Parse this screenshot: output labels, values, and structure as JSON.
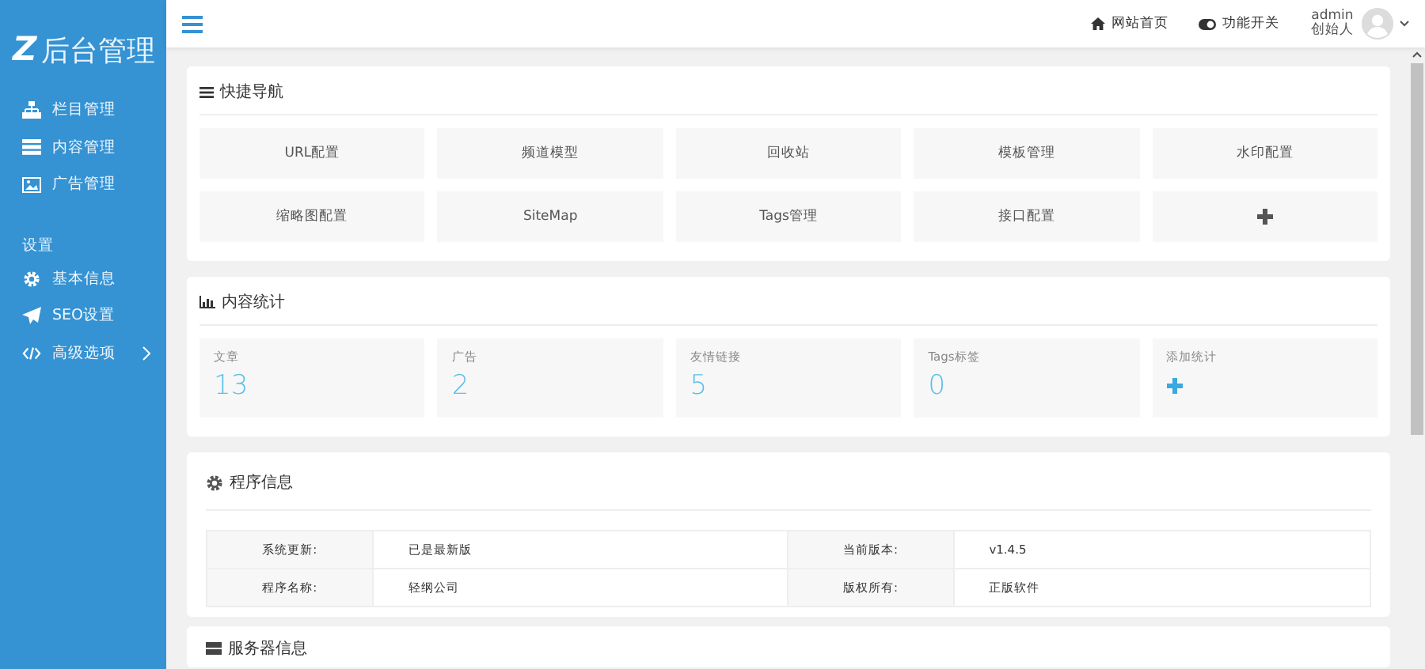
{
  "sidebar": {
    "logo_mark": "Z",
    "logo_text": "后台管理",
    "items": [
      {
        "label": "栏目管理",
        "kind": "sitemap"
      },
      {
        "label": "内容管理",
        "kind": "list"
      },
      {
        "label": "广告管理",
        "kind": "image"
      }
    ],
    "section": "设置",
    "settings_items": [
      {
        "label": "基本信息",
        "kind": "gear",
        "expandable": false
      },
      {
        "label": "SEO设置",
        "kind": "plane",
        "expandable": false
      },
      {
        "label": "高级选项",
        "kind": "code",
        "expandable": true
      }
    ]
  },
  "topbar": {
    "links": [
      {
        "label": "网站首页",
        "kind": "home"
      },
      {
        "label": "功能开关",
        "kind": "toggle"
      }
    ],
    "user": {
      "name": "admin",
      "role": "创始人"
    }
  },
  "quick_nav": {
    "title": "快捷导航",
    "items": [
      {
        "kind": "link",
        "label": "URL配置"
      },
      {
        "kind": "link",
        "label": "频道模型"
      },
      {
        "kind": "link",
        "label": "回收站"
      },
      {
        "kind": "link",
        "label": "模板管理"
      },
      {
        "kind": "link",
        "label": "水印配置"
      },
      {
        "kind": "link",
        "label": "缩略图配置"
      },
      {
        "kind": "link",
        "label": "SiteMap"
      },
      {
        "kind": "link",
        "label": "Tags管理"
      },
      {
        "kind": "link",
        "label": "接口配置"
      },
      {
        "kind": "add"
      }
    ]
  },
  "stats": {
    "title": "内容统计",
    "items": [
      {
        "kind": "count",
        "label": "文章",
        "value": "13"
      },
      {
        "kind": "count",
        "label": "广告",
        "value": "2"
      },
      {
        "kind": "count",
        "label": "友情链接",
        "value": "5"
      },
      {
        "kind": "count",
        "label": "Tags标签",
        "value": "0"
      },
      {
        "kind": "add",
        "label": "添加统计"
      }
    ]
  },
  "program_info": {
    "title": "程序信息",
    "rows": [
      [
        {
          "label": "系统更新:",
          "value": "已是最新版"
        },
        {
          "label": "当前版本:",
          "value": "v1.4.5"
        }
      ],
      [
        {
          "label": "程序名称:",
          "value": "轻纲公司"
        },
        {
          "label": "版权所有:",
          "value": "正版软件"
        }
      ]
    ]
  },
  "server_info": {
    "title": "服务器信息"
  }
}
